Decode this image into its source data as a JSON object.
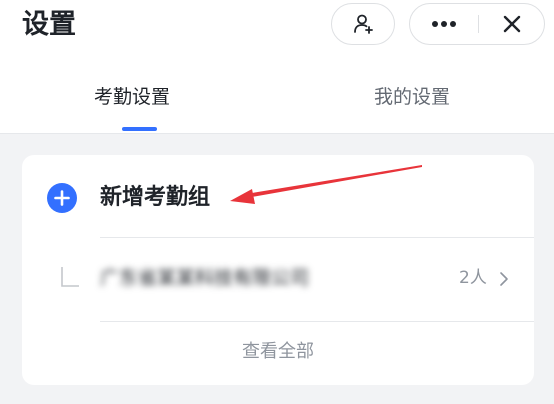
{
  "header": {
    "title": "设置",
    "add_member_icon": "add-member-icon",
    "more_icon": "more-icon",
    "close_icon": "close-icon"
  },
  "tabs": [
    {
      "label": "考勤设置",
      "active": true
    },
    {
      "label": "我的设置",
      "active": false
    }
  ],
  "card": {
    "add_group_label": "新增考勤组",
    "company": {
      "name": "广东省某某科技有限公司",
      "count": "2人"
    },
    "view_all_label": "查看全部"
  },
  "colors": {
    "accent": "#3370ff",
    "annotation_arrow": "#e8343a",
    "text_primary": "#1f2329",
    "text_secondary": "#8f959e",
    "background": "#f2f3f5"
  }
}
